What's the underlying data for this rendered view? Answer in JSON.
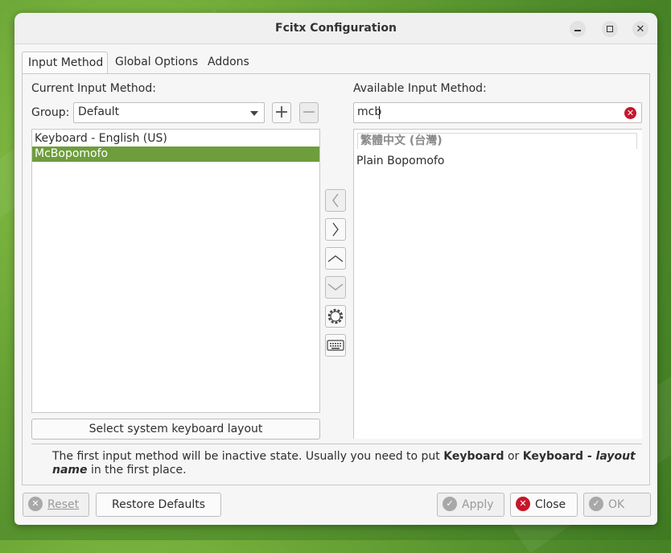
{
  "window": {
    "title": "Fcitx Configuration"
  },
  "tabs": [
    {
      "label": "Input Method",
      "active": true
    },
    {
      "label": "Global Options",
      "active": false
    },
    {
      "label": "Addons",
      "active": false
    }
  ],
  "current": {
    "heading": "Current Input Method:",
    "group_label": "Group:",
    "group_value": "Default",
    "items": [
      {
        "label": "Keyboard - English (US)",
        "selected": false
      },
      {
        "label": "McBopomofo",
        "selected": true
      }
    ],
    "keyboard_layout_button": "Select system keyboard layout"
  },
  "available": {
    "heading": "Available Input Method:",
    "search_value": "mcb",
    "group_header": "繁體中文 (台灣)",
    "items": [
      {
        "label": "Plain Bopomofo"
      }
    ]
  },
  "note": {
    "part1": "The first input method will be inactive state. Usually you need to put ",
    "bold1": "Keyboard",
    "part2": " or ",
    "bold2": "Keyboard - ",
    "italic": "layout name",
    "part3": " in the first place."
  },
  "footer": {
    "reset": "Reset",
    "restore_defaults": "Restore Defaults",
    "apply": "Apply",
    "close": "Close",
    "ok": "OK"
  },
  "colors": {
    "selection": "#6e9d3c",
    "close_icon": "#c7162b"
  }
}
